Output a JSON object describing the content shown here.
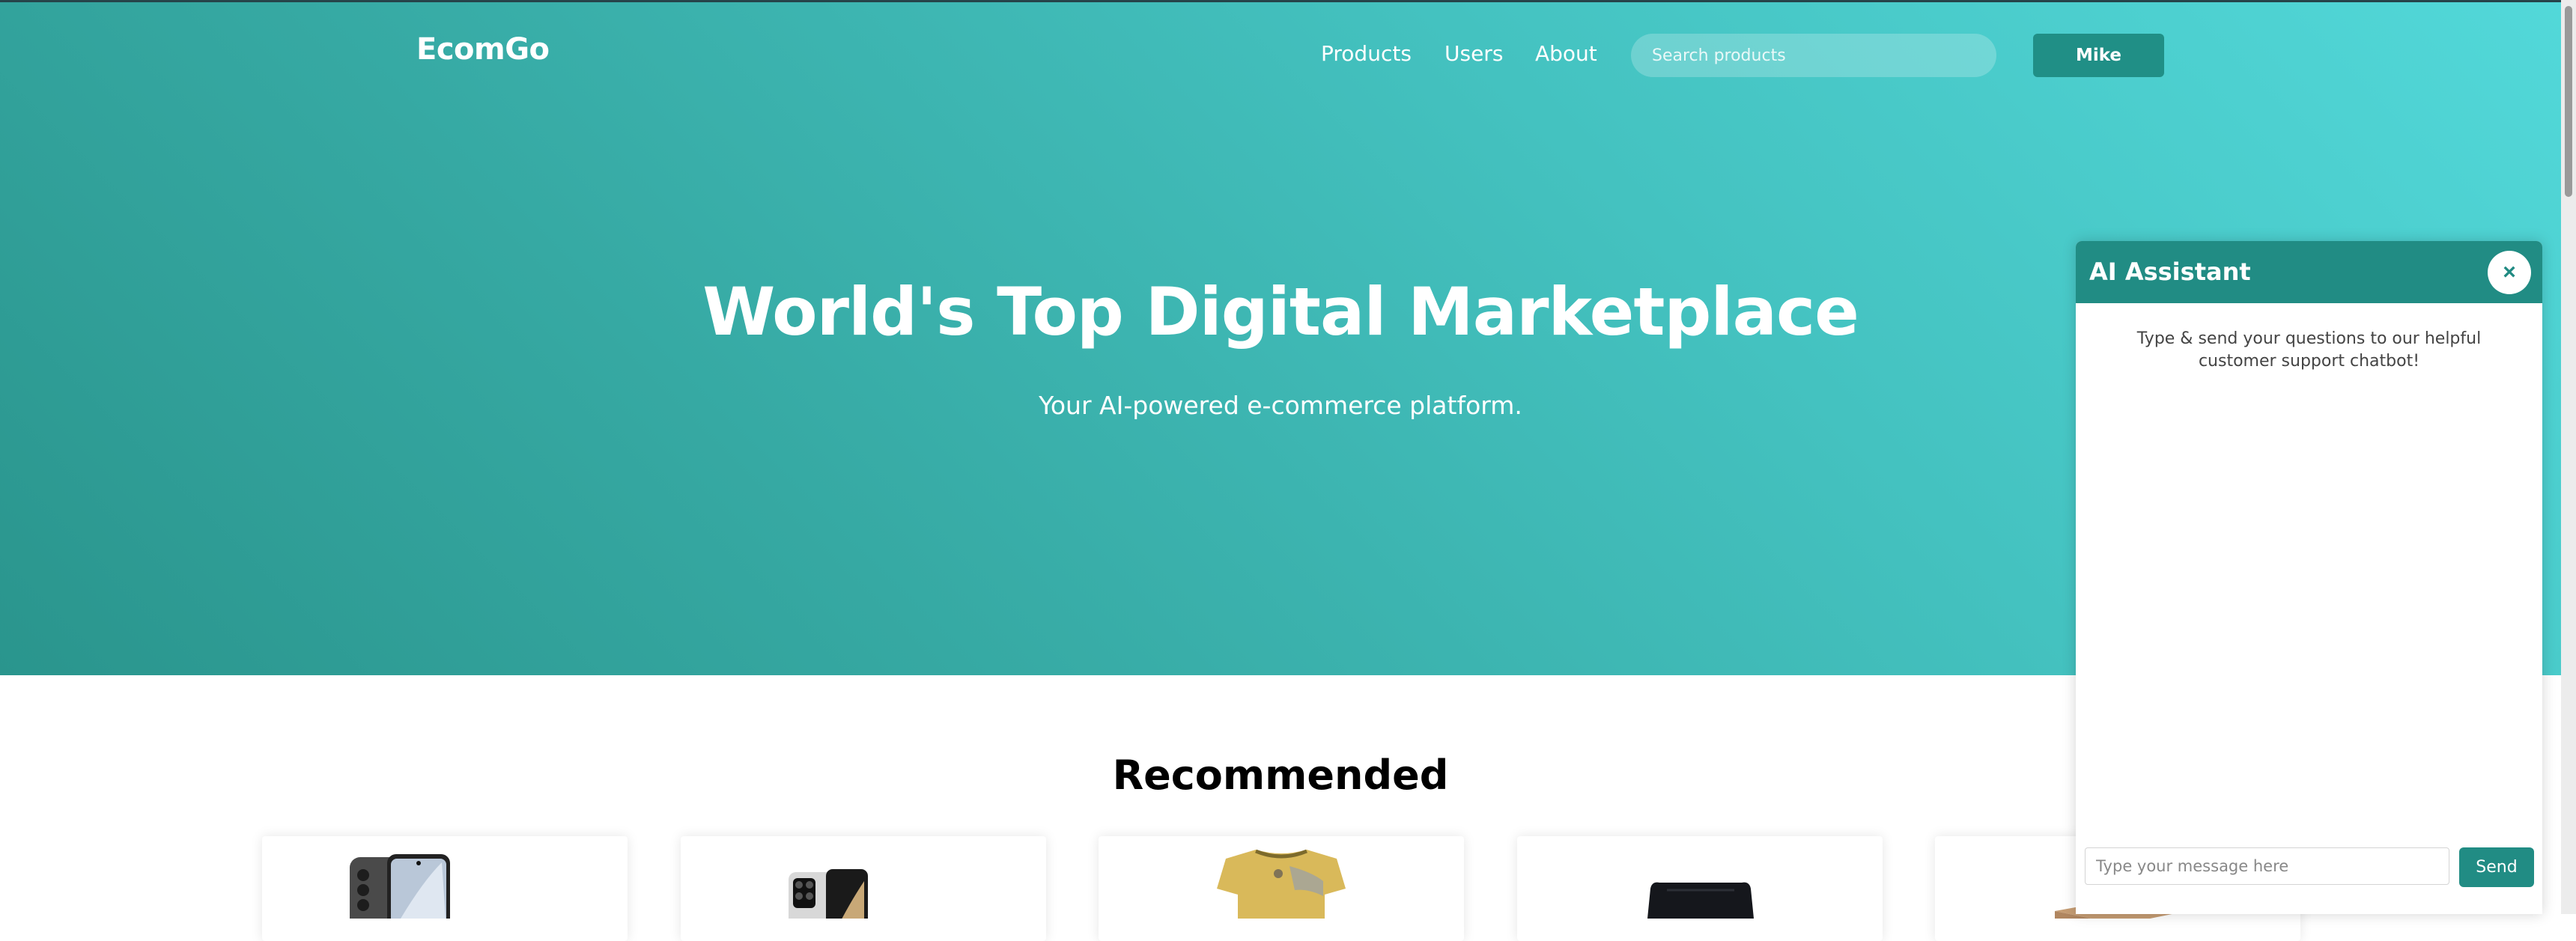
{
  "navbar": {
    "logo": "EcomGo",
    "links": [
      "Products",
      "Users",
      "About"
    ],
    "search_placeholder": "Search products",
    "user_button": "Mike"
  },
  "hero": {
    "title": "World's Top Digital Marketplace",
    "subtitle": "Your AI-powered e-commerce platform."
  },
  "recommended": {
    "title": "Recommended",
    "products": [
      {
        "image": "phone-black-icon"
      },
      {
        "image": "phone-silver-icon"
      },
      {
        "image": "tshirt-icon"
      },
      {
        "image": "shorts-icon"
      },
      {
        "image": "box-icon"
      }
    ]
  },
  "chat": {
    "title": "AI Assistant",
    "close_icon": "×",
    "intro": "Type & send your questions to our helpful customer support chatbot!",
    "input_placeholder": "Type your message here",
    "send_label": "Send"
  },
  "colors": {
    "accent": "#218c84",
    "hero_gradient_start": "#2a958d",
    "hero_gradient_end": "#52d8d9"
  }
}
